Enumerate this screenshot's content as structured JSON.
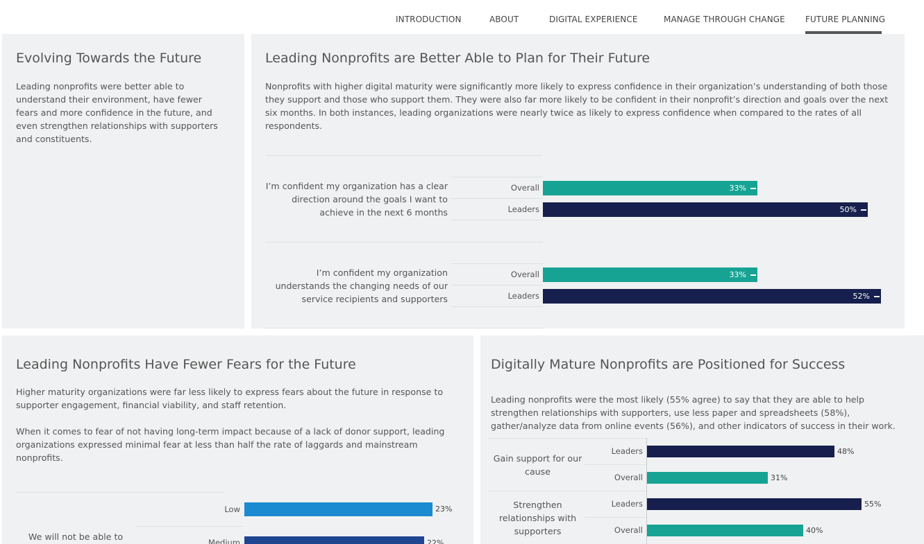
{
  "nav": {
    "items": [
      "INTRODUCTION",
      "ABOUT",
      "DIGITAL EXPERIENCE",
      "MANAGE THROUGH CHANGE",
      "FUTURE PLANNING"
    ],
    "active": "FUTURE PLANNING"
  },
  "evolving": {
    "title": "Evolving Towards the Future",
    "text": "Leading nonprofits were better able to understand their environment, have fewer fears and more confidence in the future, and even strengthen relationships with supporters and constituents."
  },
  "plan": {
    "title": "Leading Nonprofits are Better Able to Plan for Their Future",
    "text": "Nonprofits with higher digital maturity were significantly more likely to express confidence in their organization’s understanding of both those they support and those who support them. They were also far more likely to be confident in their nonprofit’s direction and goals over the next six months. In both instances, leading organizations were nearly twice as likely to express confidence when compared to the rates of all respondents.",
    "q1": "I’m confident my organization has a clear direction around the goals I want to achieve in the next 6 months",
    "q2": "I’m confident my organization understands the changing needs of our service recipients and supporters"
  },
  "fears": {
    "title": "Leading Nonprofits Have Fewer Fears for the Future",
    "text1": "Higher maturity organizations were far less likely to express fears about the future in response to supporter engagement, financial viability, and staff retention.",
    "text2": "When it comes to fear of not having long-term impact because of a lack of donor support, leading organizations expressed minimal fear at less than half the rate of laggards and mainstream nonprofits.",
    "q1": "We will not be able to"
  },
  "success": {
    "title": "Digitally Mature Nonprofits are Positioned for Success",
    "text": "Leading nonprofits were the most likely (55% agree) to say that they are able to help strengthen relationships with supporters, use less paper and spreadsheets (58%), gather/analyze data from online events (56%), and other indicators of success in their work.",
    "q1": "Gain support for our cause",
    "q2": "Strengthen relationships with supporters"
  },
  "colors": {
    "teal": "#16a394",
    "navy": "#161f4d",
    "blue": "#1a8ad1",
    "darkblue": "#1f4591"
  },
  "chart_data": [
    {
      "type": "bar",
      "orientation": "horizontal",
      "categories": [
        "I’m confident my organization has a clear direction around the goals I want to achieve in the next 6 months",
        "I’m confident my organization understands the changing needs of our service recipients and supporters"
      ],
      "series": [
        {
          "name": "Overall",
          "values": [
            33,
            33
          ],
          "labels": [
            "33%",
            "33%"
          ]
        },
        {
          "name": "Leaders",
          "values": [
            50,
            52
          ],
          "labels": [
            "50%",
            "52%"
          ]
        }
      ]
    },
    {
      "type": "bar",
      "orientation": "horizontal",
      "categories": [
        "Gain support for our cause",
        "Strengthen relationships with supporters"
      ],
      "series": [
        {
          "name": "Leaders",
          "values": [
            48,
            55
          ],
          "labels": [
            "48%",
            "55%"
          ]
        },
        {
          "name": "Overall",
          "values": [
            31,
            40
          ],
          "labels": [
            "31%",
            "40%"
          ]
        }
      ]
    },
    {
      "type": "bar",
      "orientation": "horizontal",
      "categories": [
        "We will not be able to"
      ],
      "series": [
        {
          "name": "Low",
          "values": [
            23
          ],
          "labels": [
            "23%"
          ]
        },
        {
          "name": "Medium",
          "values": [
            22
          ],
          "labels": [
            "22%"
          ]
        }
      ]
    }
  ]
}
